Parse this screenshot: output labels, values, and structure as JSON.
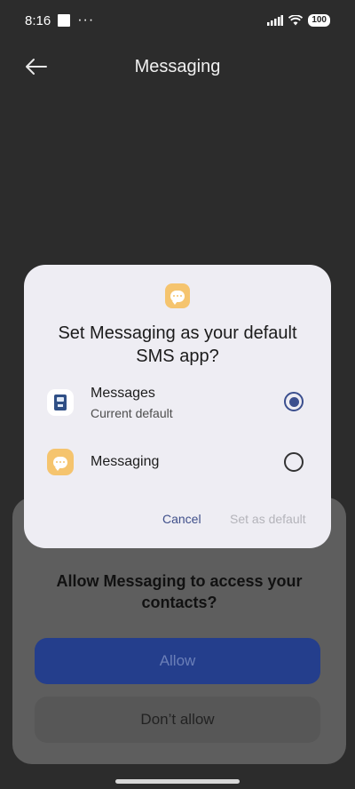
{
  "status_bar": {
    "time": "8:16",
    "dots": "···",
    "battery": "100"
  },
  "app_bar": {
    "title": "Messaging"
  },
  "dialog": {
    "title": "Set Messaging as your default SMS app?",
    "options": [
      {
        "label": "Messages",
        "sublabel": "Current default",
        "selected": true
      },
      {
        "label": "Messaging",
        "sublabel": "",
        "selected": false
      }
    ],
    "cancel_label": "Cancel",
    "confirm_label": "Set as default"
  },
  "permission_sheet": {
    "title": "Allow Messaging to access your contacts?",
    "allow_label": "Allow",
    "deny_label": "Don’t allow"
  },
  "colors": {
    "accent": "#3b4f8e",
    "app_icon": "#f5c46e",
    "allow_button": "#243e8c"
  }
}
